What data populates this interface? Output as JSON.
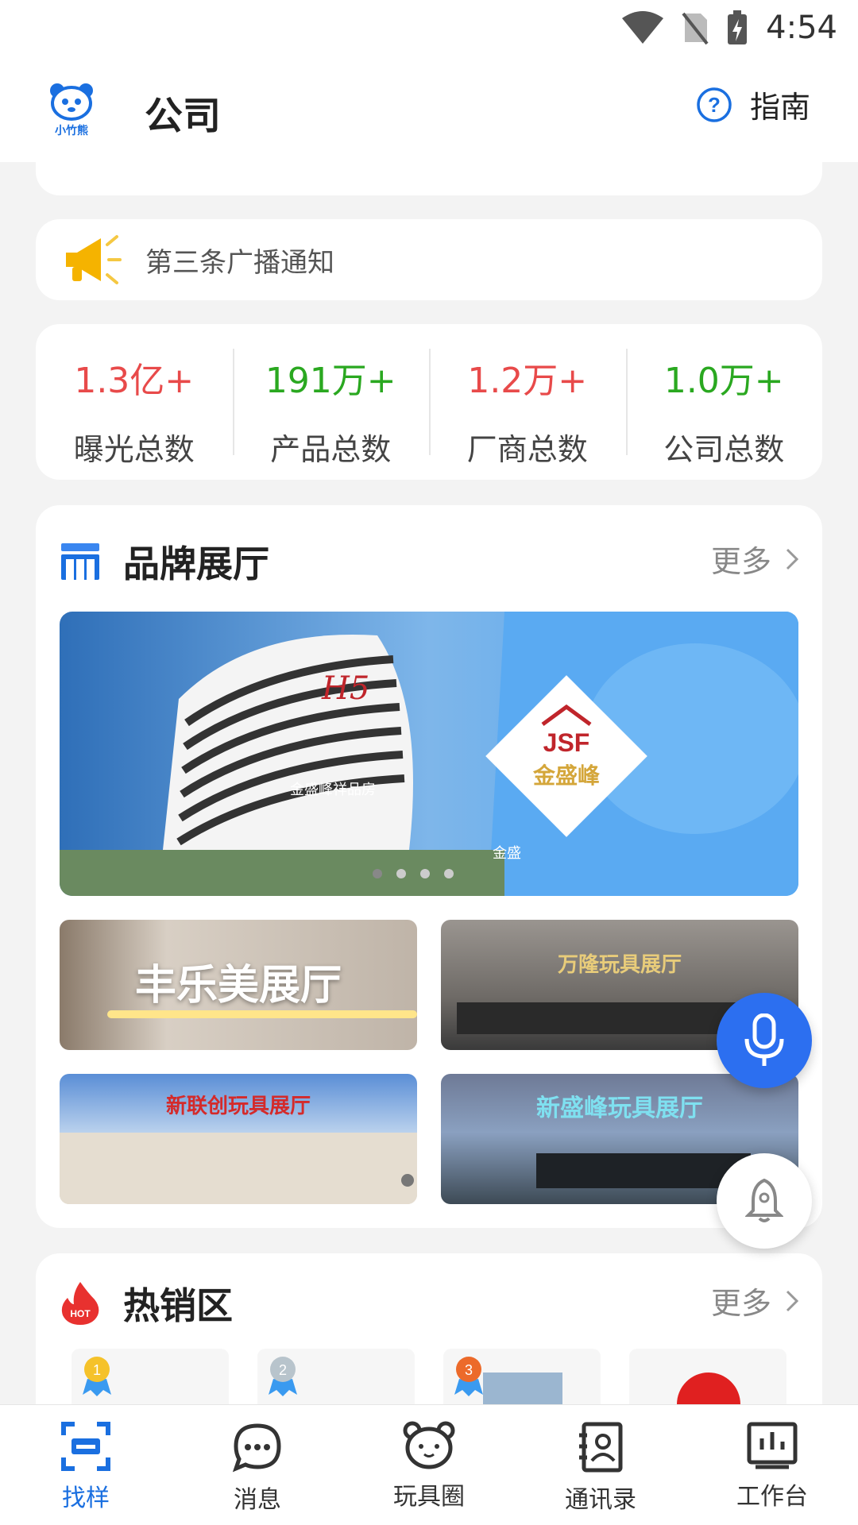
{
  "status_bar": {
    "time": "4:54"
  },
  "header": {
    "title": "公司",
    "logo_text": "小竹熊",
    "guide_label": "指南"
  },
  "notice": {
    "text": "第三条广播通知"
  },
  "stats": [
    {
      "value": "1.3亿+",
      "label": "曝光总数",
      "color": "#e84a4a"
    },
    {
      "value": "191万+",
      "label": "产品总数",
      "color": "#2aa820"
    },
    {
      "value": "1.2万+",
      "label": "厂商总数",
      "color": "#e84a4a"
    },
    {
      "value": "1.0万+",
      "label": "公司总数",
      "color": "#2aa820"
    }
  ],
  "brand_hall": {
    "title": "品牌展厅",
    "more": "更多",
    "banner": {
      "sign": "H5",
      "building_sign": "金盛峰祥品房",
      "logo_top": "JSF",
      "logo_name": "金盛峰",
      "caption": "金盛"
    },
    "thumbs": [
      {
        "caption": "丰乐美展厅"
      },
      {
        "caption": "万隆玩具展厅"
      },
      {
        "caption": "新联创玩具展厅"
      },
      {
        "caption": "新盛峰玩具展厅"
      }
    ]
  },
  "hot": {
    "title": "热销区",
    "more": "更多",
    "hot_badge": "HOT",
    "ranks": [
      "1",
      "2",
      "3"
    ]
  },
  "bottom_nav": [
    {
      "label": "找样",
      "active": true
    },
    {
      "label": "消息"
    },
    {
      "label": "玩具圈"
    },
    {
      "label": "通讯录"
    },
    {
      "label": "工作台"
    }
  ],
  "colors": {
    "accent": "#1a6fe0",
    "red": "#e84a4a",
    "green": "#2aa820"
  }
}
